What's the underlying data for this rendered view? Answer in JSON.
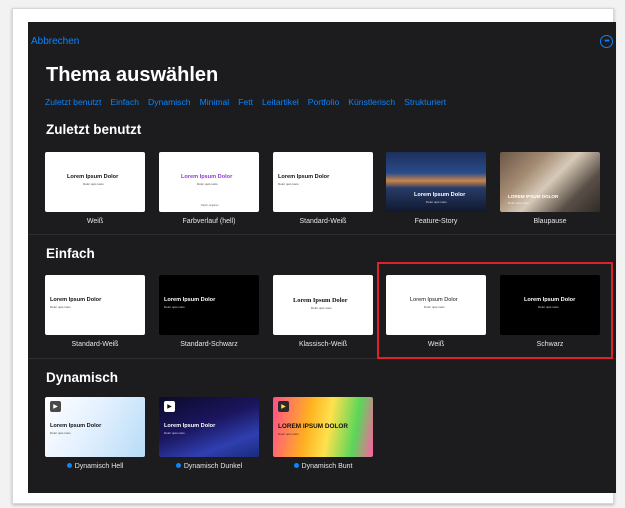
{
  "header": {
    "cancel_label": "Abbrechen",
    "title": "Thema auswählen",
    "more_icon": "ellipsis-circle-icon"
  },
  "filters": [
    "Zuletzt benutzt",
    "Einfach",
    "Dynamisch",
    "Minimal",
    "Fett",
    "Leitartikel",
    "Portfolio",
    "Künstlerisch",
    "Strukturiert"
  ],
  "sections": {
    "recent": {
      "title": "Zuletzt benutzt",
      "cards": [
        {
          "caption": "Weiß",
          "thumb_title": "Lorem Ipsum Dolor",
          "thumb_sub": "Dolor quis iusto"
        },
        {
          "caption": "Farbverlauf (hell)",
          "thumb_title": "Lorem Ipsum Dolor",
          "thumb_sub": "Dolor quis iusto",
          "thumb_foot": "Datum eingeben"
        },
        {
          "caption": "Standard-Weiß",
          "thumb_title": "Lorem Ipsum Dolor",
          "thumb_sub": "Dolor quis iusto"
        },
        {
          "caption": "Feature-Story",
          "thumb_title": "Lorem Ipsum Dolor",
          "thumb_sub": "Dolor quis iusto"
        },
        {
          "caption": "Blaupause",
          "thumb_title": "LOREM IPSUM DOLOR",
          "thumb_sub": "Dolor quis iusto"
        }
      ]
    },
    "simple": {
      "title": "Einfach",
      "cards": [
        {
          "caption": "Standard-Weiß",
          "thumb_title": "Lorem Ipsum Dolor",
          "thumb_sub": "Dolor quis iusto"
        },
        {
          "caption": "Standard-Schwarz",
          "thumb_title": "Lorem Ipsum Dolor",
          "thumb_sub": "Dolor quis iusto"
        },
        {
          "caption": "Klassisch-Weiß",
          "thumb_title": "Lorem Ipsum Dolor",
          "thumb_sub": "Dolor quis iusto"
        },
        {
          "caption": "Weiß",
          "thumb_title": "Lorem Ipsum Dolor",
          "thumb_sub": "Dolor quis iusto"
        },
        {
          "caption": "Schwarz",
          "thumb_title": "Lorem Ipsum Dolor",
          "thumb_sub": "Dolor quis iusto"
        }
      ]
    },
    "dynamic": {
      "title": "Dynamisch",
      "cards": [
        {
          "caption": "Dynamisch Hell",
          "thumb_title": "Lorem Ipsum Dolor",
          "thumb_sub": "Dolor quis iusto"
        },
        {
          "caption": "Dynamisch Dunkel",
          "thumb_title": "Lorem Ipsum Dolor",
          "thumb_sub": "Dolor quis iusto"
        },
        {
          "caption": "Dynamisch Bunt",
          "thumb_title": "LOREM IPSUM DOLOR",
          "thumb_sub": "Dolor quis iusto"
        }
      ]
    }
  },
  "colors": {
    "accent": "#0a84ff",
    "background": "#1c1c1e",
    "selection_highlight": "#e0202a"
  }
}
